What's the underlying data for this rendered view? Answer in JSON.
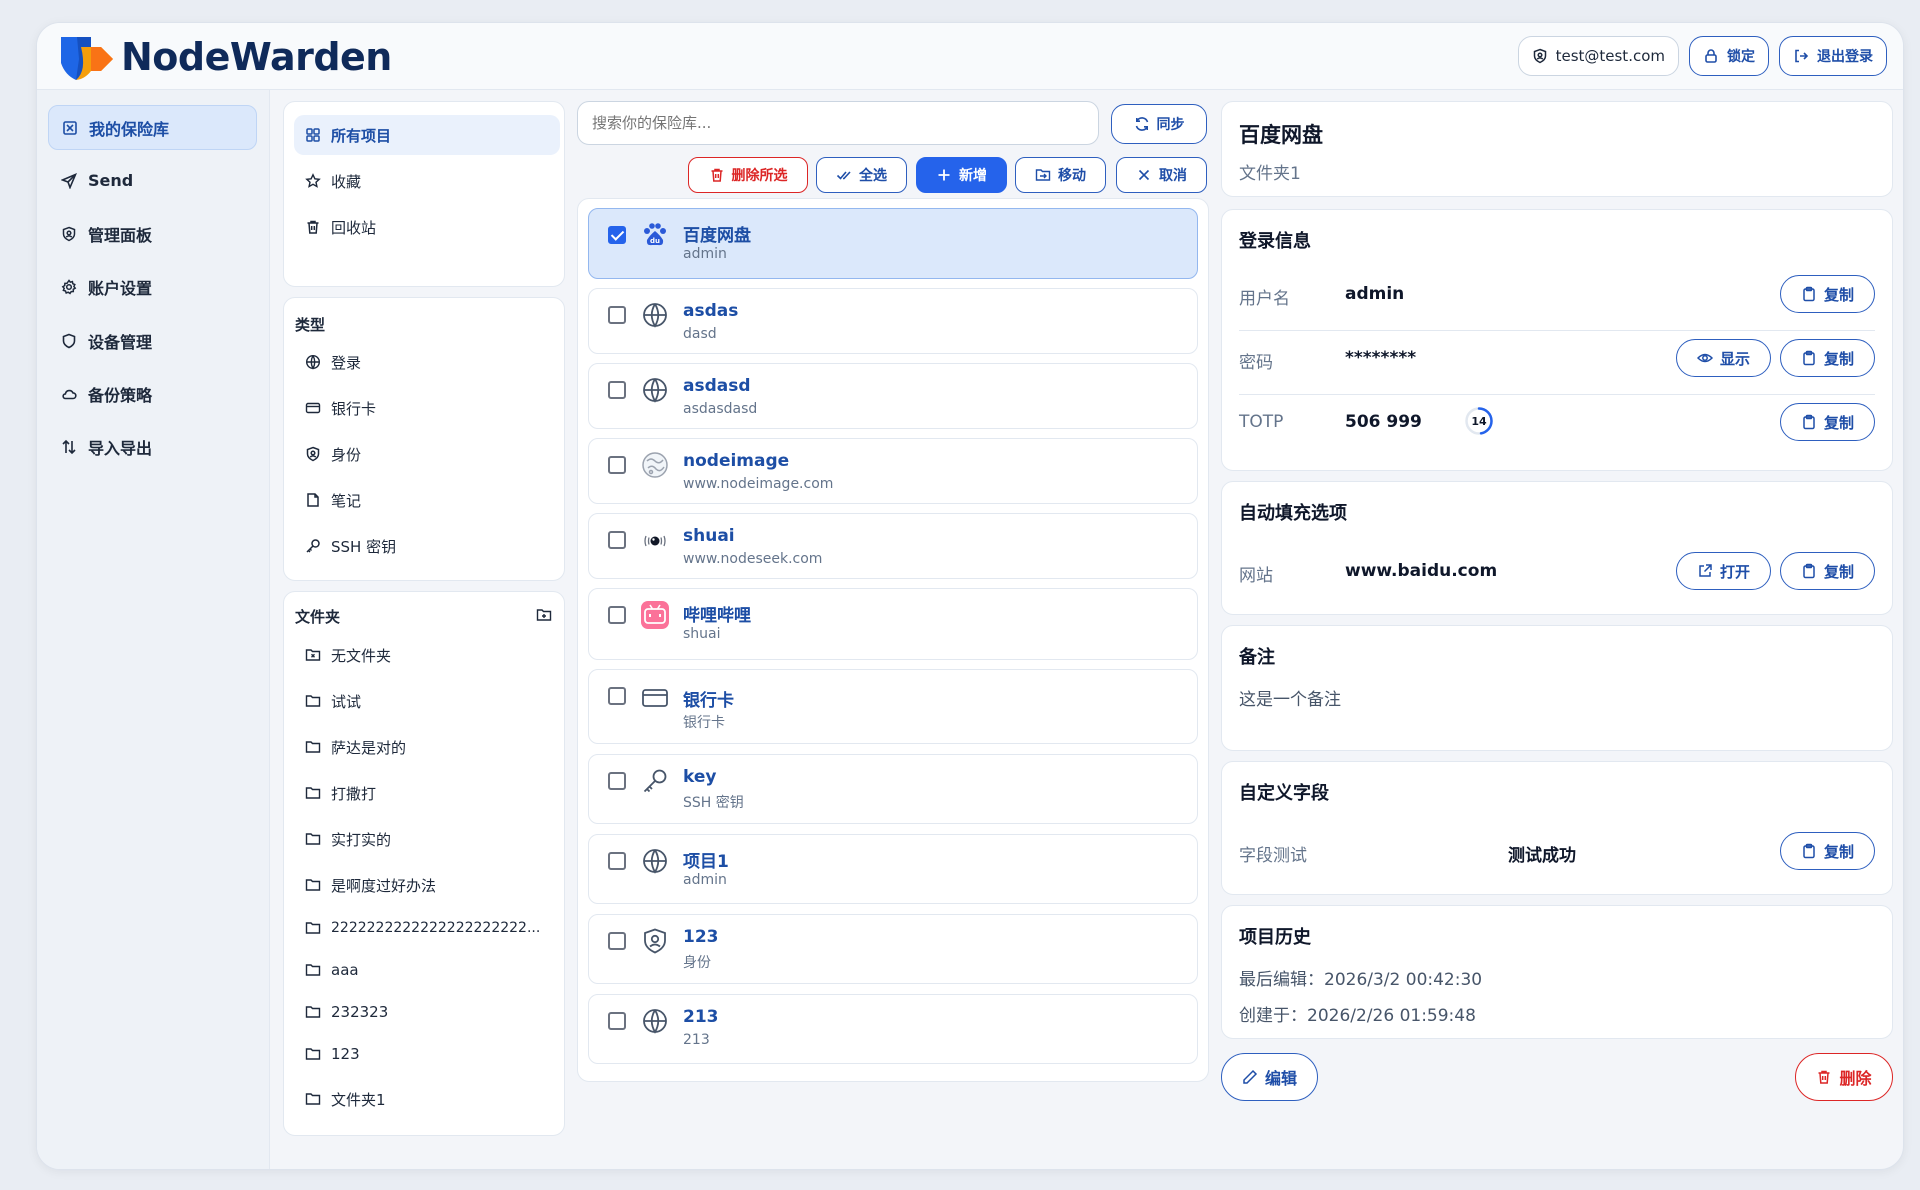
{
  "app": {
    "brand": "NodeWarden",
    "accent": "#2563eb",
    "danger": "#dc2626"
  },
  "header": {
    "user_email": "test@test.com",
    "lock_label": "锁定",
    "logout_label": "退出登录"
  },
  "nav": {
    "items": [
      {
        "label": "我的保险库",
        "icon": "vault-icon",
        "active": true
      },
      {
        "label": "Send",
        "icon": "send-icon"
      },
      {
        "label": "管理面板",
        "icon": "admin-shield-icon"
      },
      {
        "label": "账户设置",
        "icon": "gear-icon"
      },
      {
        "label": "设备管理",
        "icon": "shield-icon"
      },
      {
        "label": "备份策略",
        "icon": "cloud-icon"
      },
      {
        "label": "导入导出",
        "icon": "arrows-updown-icon"
      }
    ]
  },
  "filters": {
    "quick": [
      {
        "label": "所有项目",
        "icon": "grid-icon",
        "active": true
      },
      {
        "label": "收藏",
        "icon": "star-icon"
      },
      {
        "label": "回收站",
        "icon": "trash-icon"
      }
    ],
    "types_title": "类型",
    "types": [
      {
        "label": "登录",
        "icon": "globe-icon"
      },
      {
        "label": "银行卡",
        "icon": "card-icon"
      },
      {
        "label": "身份",
        "icon": "identity-icon"
      },
      {
        "label": "笔记",
        "icon": "note-icon"
      },
      {
        "label": "SSH 密钥",
        "icon": "key-icon"
      }
    ],
    "folders_title": "文件夹",
    "folders": [
      {
        "label": "无文件夹",
        "icon": "folder-x-icon"
      },
      {
        "label": "试试",
        "icon": "folder-icon"
      },
      {
        "label": "萨达是对的",
        "icon": "folder-icon"
      },
      {
        "label": "打撒打",
        "icon": "folder-icon"
      },
      {
        "label": "实打实的",
        "icon": "folder-icon"
      },
      {
        "label": "是啊度过好办法",
        "icon": "folder-icon"
      },
      {
        "label": "2222222222222222222222...",
        "icon": "folder-icon"
      },
      {
        "label": "aaa",
        "icon": "folder-icon"
      },
      {
        "label": "232323",
        "icon": "folder-icon"
      },
      {
        "label": "123",
        "icon": "folder-icon"
      },
      {
        "label": "文件夹1",
        "icon": "folder-icon"
      }
    ]
  },
  "list": {
    "search_placeholder": "搜索你的保险库...",
    "sync_label": "同步",
    "actions": {
      "delete_selected": "删除所选",
      "select_all": "全选",
      "add": "新增",
      "move": "移动",
      "cancel": "取消"
    },
    "items": [
      {
        "name": "百度网盘",
        "sub": "admin",
        "icon": "baidu-icon",
        "checked": true
      },
      {
        "name": "asdas",
        "sub": "dasd",
        "icon": "globe-icon",
        "checked": false
      },
      {
        "name": "asdasd",
        "sub": "asdasdasd",
        "icon": "globe-icon",
        "checked": false
      },
      {
        "name": "nodeimage",
        "sub": "www.nodeimage.com",
        "icon": "nodeimage-icon",
        "checked": false
      },
      {
        "name": "shuai",
        "sub": "www.nodeseek.com",
        "icon": "nodeseek-icon",
        "checked": false
      },
      {
        "name": "哔哩哔哩",
        "sub": "shuai",
        "icon": "bilibili-icon",
        "checked": false
      },
      {
        "name": "银行卡",
        "sub": "银行卡",
        "icon": "card-icon",
        "checked": false
      },
      {
        "name": "key",
        "sub": "SSH 密钥",
        "icon": "key-icon",
        "checked": false
      },
      {
        "name": "项目1",
        "sub": "admin",
        "icon": "globe-icon",
        "checked": false
      },
      {
        "name": "123",
        "sub": "身份",
        "icon": "identity-icon",
        "checked": false
      },
      {
        "name": "213",
        "sub": "213",
        "icon": "globe-icon",
        "checked": false
      }
    ]
  },
  "detail": {
    "title": "百度网盘",
    "folder": "文件夹1",
    "login": {
      "title": "登录信息",
      "username_label": "用户名",
      "username": "admin",
      "password_label": "密码",
      "password": "********",
      "totp_label": "TOTP",
      "totp": "506 999",
      "totp_seconds": "14",
      "totp_remaining_fraction": 0.47,
      "show_label": "显示",
      "copy_label": "复制"
    },
    "autofill": {
      "title": "自动填充选项",
      "site_label": "网站",
      "site": "www.baidu.com",
      "open_label": "打开",
      "copy_label": "复制"
    },
    "notes": {
      "title": "备注",
      "text": "这是一个备注"
    },
    "custom": {
      "title": "自定义字段",
      "field_label": "字段测试",
      "field_value": "测试成功",
      "copy_label": "复制"
    },
    "history": {
      "title": "项目历史",
      "edited": "最后编辑：2026/3/2 00:42:30",
      "created": "创建于：2026/2/26 01:59:48"
    },
    "edit_label": "编辑",
    "delete_label": "删除"
  }
}
